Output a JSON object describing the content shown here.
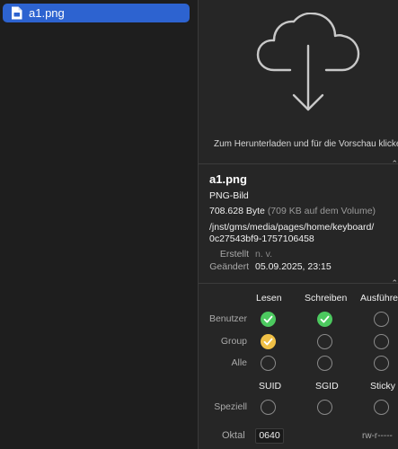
{
  "file_list": {
    "items": [
      {
        "name": "a1.png",
        "icon": "image-file-icon",
        "selected": true
      }
    ]
  },
  "preview": {
    "icon": "cloud-download-icon",
    "hint": "Zum Herunterladen und für die Vorschau klicken"
  },
  "info": {
    "name": "a1.png",
    "kind": "PNG-Bild",
    "size": "708.628 Byte",
    "size_on_volume": "(709 KB auf dem Volume)",
    "path_line1": "/jnst/gms/media/pages/home/keyboard/",
    "path_line2": "0c27543bf9-1757106458",
    "created_label": "Erstellt",
    "created_value": "n. v.",
    "modified_label": "Geändert",
    "modified_value": "05.09.2025, 23:15"
  },
  "permissions": {
    "columns": [
      "Lesen",
      "Schreiben",
      "Ausführen"
    ],
    "rows": [
      {
        "label": "Benutzer",
        "states": [
          "green",
          "green",
          "off"
        ]
      },
      {
        "label": "Group",
        "states": [
          "yellow",
          "off",
          "off"
        ]
      },
      {
        "label": "Alle",
        "states": [
          "off",
          "off",
          "off"
        ]
      }
    ],
    "special_columns": [
      "SUID",
      "SGID",
      "Sticky"
    ],
    "special_row": {
      "label": "Speziell",
      "states": [
        "off",
        "off",
        "off"
      ]
    },
    "octal_label": "Oktal",
    "octal_value": "0640",
    "symbolic": "rw-r-----"
  },
  "colors": {
    "selection": "#2d63d0",
    "check_green": "#4cc95f",
    "check_yellow": "#f0c046"
  }
}
